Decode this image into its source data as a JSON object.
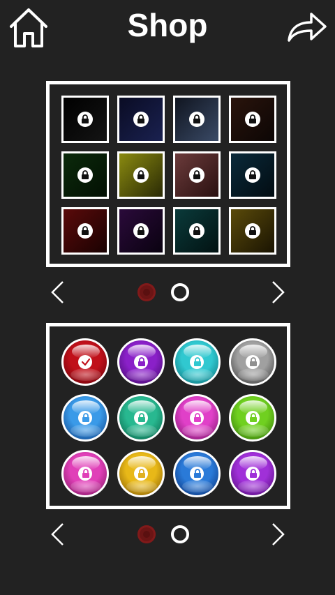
{
  "header": {
    "title": "Shop",
    "home_icon": "home-icon",
    "share_icon": "share-arrow-icon"
  },
  "backgrounds": {
    "items": [
      {
        "color_a": "#000000",
        "color_b": "#141414",
        "locked": true
      },
      {
        "color_a": "#0a0c24",
        "color_b": "#1a2150",
        "locked": true
      },
      {
        "color_a": "#101520",
        "color_b": "#3a4a66",
        "locked": true
      },
      {
        "color_a": "#2a140c",
        "color_b": "#0c0605",
        "locked": true
      },
      {
        "color_a": "#0b2a0b",
        "color_b": "#031003",
        "locked": true
      },
      {
        "color_a": "#8a8a10",
        "color_b": "#2a2a05",
        "locked": true
      },
      {
        "color_a": "#6b3b3b",
        "color_b": "#2a1010",
        "locked": true
      },
      {
        "color_a": "#0a2a3a",
        "color_b": "#020c12",
        "locked": true
      },
      {
        "color_a": "#5a0a0a",
        "color_b": "#1a0202",
        "locked": true
      },
      {
        "color_a": "#2a0a3a",
        "color_b": "#0a0210",
        "locked": true
      },
      {
        "color_a": "#0a3a3a",
        "color_b": "#021212",
        "locked": true
      },
      {
        "color_a": "#5a4a0a",
        "color_b": "#1a1402",
        "locked": true
      }
    ],
    "pager": {
      "pages": 2,
      "current": 1
    }
  },
  "balls": {
    "items": [
      {
        "color": "#c0101a",
        "dark": "#600008",
        "badge": "check",
        "badge_color": "#c0101a"
      },
      {
        "color": "#8a20c8",
        "dark": "#3a0860",
        "badge": "lock",
        "badge_color": "#8a20c8"
      },
      {
        "color": "#30c8d0",
        "dark": "#0a6870",
        "badge": "lock",
        "badge_color": "#30c8d0"
      },
      {
        "color": "#a0a0a0",
        "dark": "#303030",
        "badge": "lock",
        "badge_color": "#909090"
      },
      {
        "color": "#3a9ae8",
        "dark": "#0a3a80",
        "badge": "lock",
        "badge_color": "#3a9ae8"
      },
      {
        "color": "#28b890",
        "dark": "#065a40",
        "badge": "lock",
        "badge_color": "#28b890"
      },
      {
        "color": "#e040c8",
        "dark": "#701060",
        "badge": "lock",
        "badge_color": "#e040c8"
      },
      {
        "color": "#70d020",
        "dark": "#2a6a04",
        "badge": "lock",
        "badge_color": "#70d020"
      },
      {
        "color": "#e040b8",
        "dark": "#781058",
        "badge": "lock",
        "badge_color": "#e040b8"
      },
      {
        "color": "#e8b818",
        "dark": "#7a5202",
        "badge": "lock",
        "badge_color": "#e0b020"
      },
      {
        "color": "#2a7ad8",
        "dark": "#062a70",
        "badge": "lock",
        "badge_color": "#2a7ad8"
      },
      {
        "color": "#a030d8",
        "dark": "#4a0870",
        "badge": "lock",
        "badge_color": "#a030d8"
      }
    ],
    "pager": {
      "pages": 2,
      "current": 1
    }
  },
  "colors": {
    "background": "#222222",
    "frame": "#ffffff",
    "active_dot": "#6b1515"
  }
}
